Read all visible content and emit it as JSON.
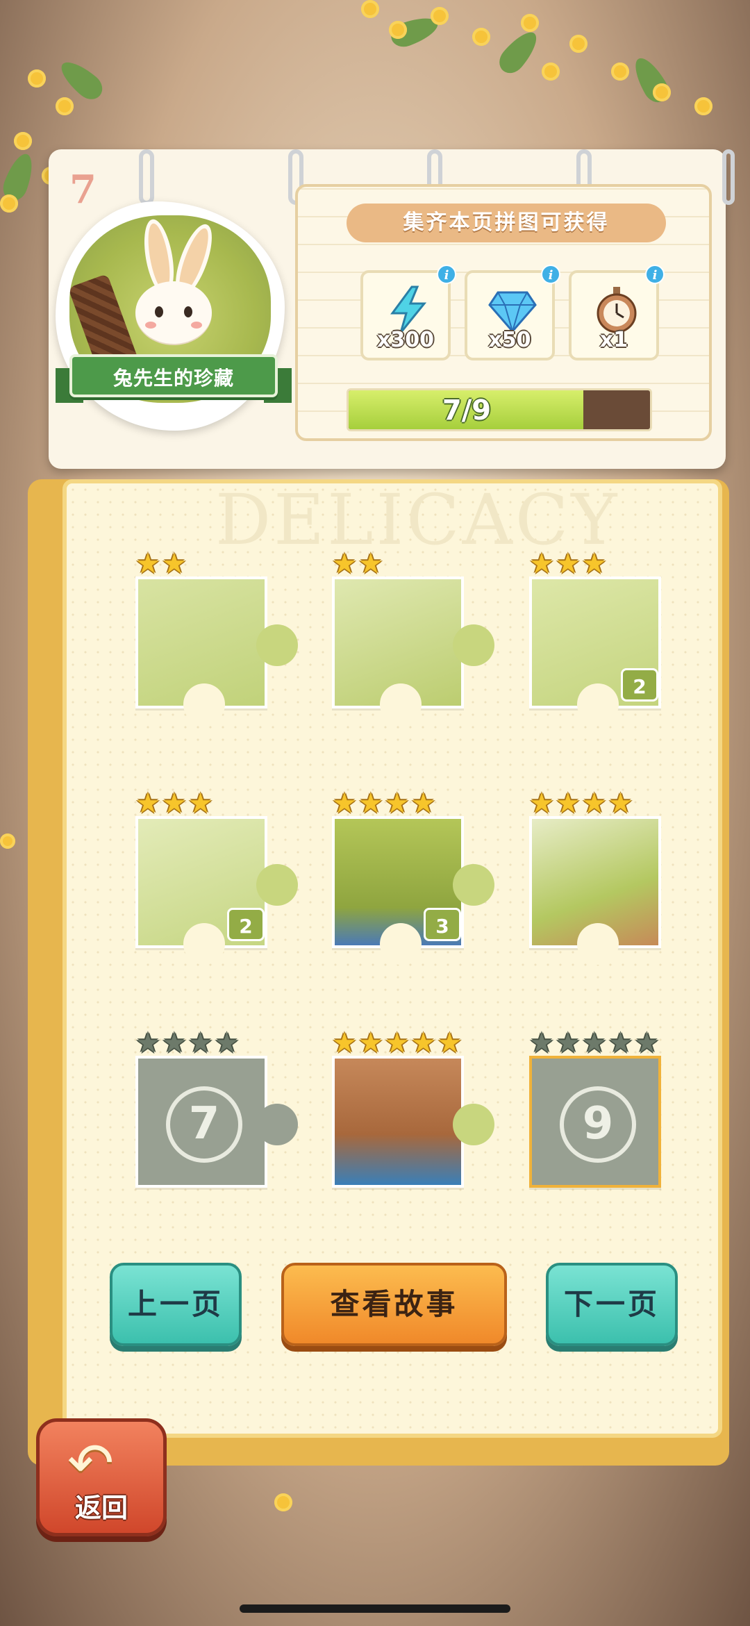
{
  "page_number": "7",
  "badge": {
    "title": "兔先生的珍藏"
  },
  "rewards": {
    "title": "集齐本页拼图可获得",
    "items": [
      {
        "icon": "lightning-energy-icon",
        "qty": "x300"
      },
      {
        "icon": "diamond-gem-icon",
        "qty": "x50"
      },
      {
        "icon": "stopwatch-icon",
        "qty": "x1"
      }
    ],
    "progress_text": "7/9",
    "progress_fraction": 0.778
  },
  "watermark": "DELICACY",
  "pieces": [
    {
      "stars": 2,
      "max_stars": 2,
      "unlocked": true,
      "count": ""
    },
    {
      "stars": 2,
      "max_stars": 2,
      "unlocked": true,
      "count": ""
    },
    {
      "stars": 3,
      "max_stars": 3,
      "unlocked": true,
      "count": "2"
    },
    {
      "stars": 3,
      "max_stars": 3,
      "unlocked": true,
      "count": "2"
    },
    {
      "stars": 4,
      "max_stars": 4,
      "unlocked": true,
      "count": "3"
    },
    {
      "stars": 4,
      "max_stars": 4,
      "unlocked": true,
      "count": ""
    },
    {
      "stars": 0,
      "max_stars": 4,
      "unlocked": false,
      "locked_label": "7"
    },
    {
      "stars": 5,
      "max_stars": 5,
      "unlocked": true,
      "count": ""
    },
    {
      "stars": 0,
      "max_stars": 5,
      "unlocked": false,
      "locked_label": "9"
    }
  ],
  "buttons": {
    "prev": "上一页",
    "story": "查看故事",
    "next": "下一页",
    "back": "返回"
  },
  "colors": {
    "accent_green": "#93ac46",
    "teal_button": "#3cc0ad",
    "orange_button": "#f0892a",
    "back_button": "#d0472b",
    "star_gold": "#f7c52b"
  }
}
